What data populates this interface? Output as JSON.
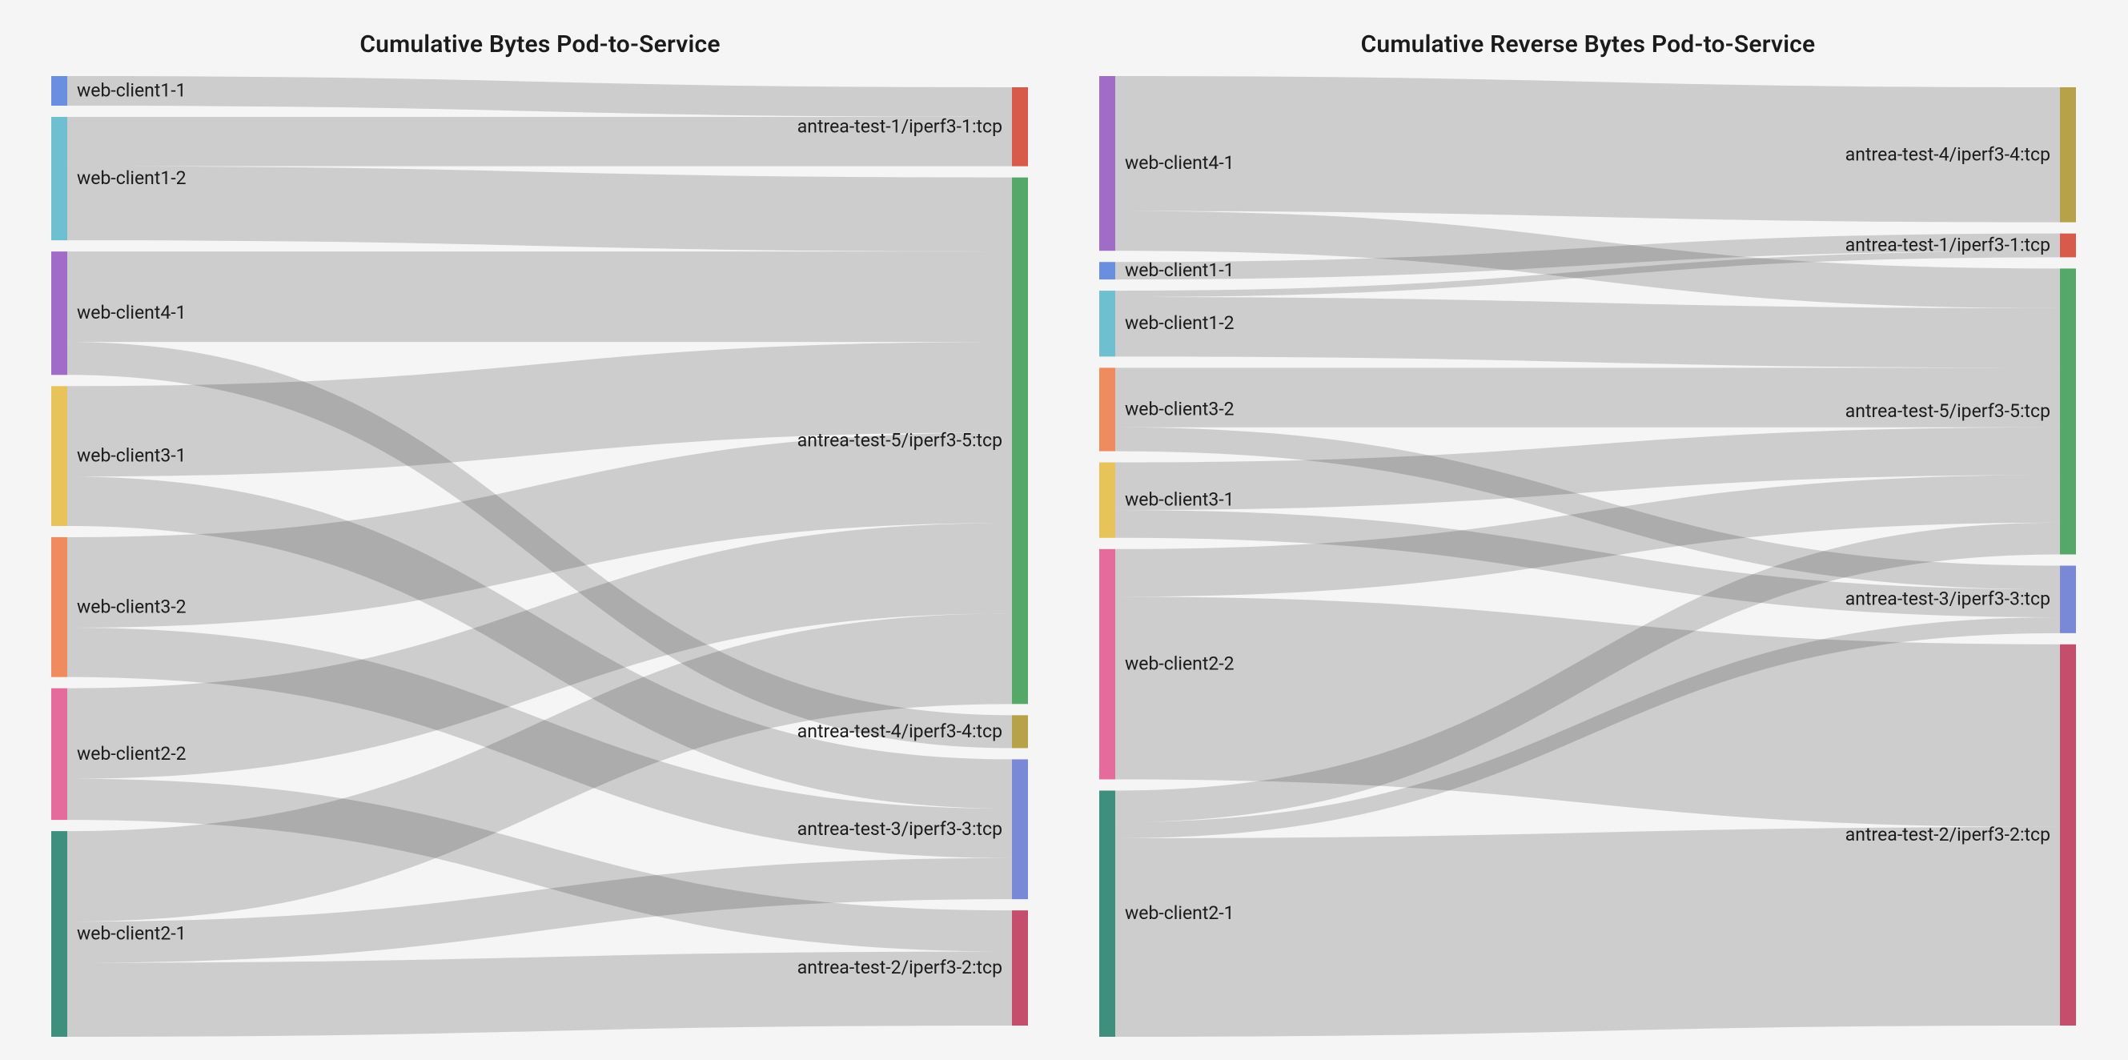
{
  "chart_data": [
    {
      "type": "sankey",
      "title": "Cumulative Bytes Pod-to-Service",
      "nodes": [
        {
          "id": "web-client1-1",
          "side": "L",
          "color": "#6b8fe0"
        },
        {
          "id": "web-client1-2",
          "side": "L",
          "color": "#6ec0d0"
        },
        {
          "id": "web-client4-1",
          "side": "L",
          "color": "#a06cc8"
        },
        {
          "id": "web-client3-1",
          "side": "L",
          "color": "#e7c35a"
        },
        {
          "id": "web-client3-2",
          "side": "L",
          "color": "#f08a5f"
        },
        {
          "id": "web-client2-2",
          "side": "L",
          "color": "#e66b9d"
        },
        {
          "id": "web-client2-1",
          "side": "L",
          "color": "#3f8f7f"
        },
        {
          "id": "antrea-test-1/iperf3-1:tcp",
          "side": "R",
          "color": "#d85a4a"
        },
        {
          "id": "antrea-test-5/iperf3-5:tcp",
          "side": "R",
          "color": "#55a868"
        },
        {
          "id": "antrea-test-4/iperf3-4:tcp",
          "side": "R",
          "color": "#b7a24a"
        },
        {
          "id": "antrea-test-3/iperf3-3:tcp",
          "side": "R",
          "color": "#7a88d8"
        },
        {
          "id": "antrea-test-2/iperf3-2:tcp",
          "side": "R",
          "color": "#c44e6b"
        }
      ],
      "links": [
        {
          "source": "web-client1-1",
          "target": "antrea-test-1/iperf3-1:tcp",
          "value": 36
        },
        {
          "source": "web-client1-2",
          "target": "antrea-test-1/iperf3-1:tcp",
          "value": 60
        },
        {
          "source": "web-client1-2",
          "target": "antrea-test-5/iperf3-5:tcp",
          "value": 90
        },
        {
          "source": "web-client4-1",
          "target": "antrea-test-5/iperf3-5:tcp",
          "value": 110
        },
        {
          "source": "web-client4-1",
          "target": "antrea-test-4/iperf3-4:tcp",
          "value": 40
        },
        {
          "source": "web-client3-1",
          "target": "antrea-test-5/iperf3-5:tcp",
          "value": 110
        },
        {
          "source": "web-client3-1",
          "target": "antrea-test-3/iperf3-3:tcp",
          "value": 60
        },
        {
          "source": "web-client3-2",
          "target": "antrea-test-5/iperf3-5:tcp",
          "value": 110
        },
        {
          "source": "web-client3-2",
          "target": "antrea-test-3/iperf3-3:tcp",
          "value": 60
        },
        {
          "source": "web-client2-2",
          "target": "antrea-test-5/iperf3-5:tcp",
          "value": 110
        },
        {
          "source": "web-client2-2",
          "target": "antrea-test-2/iperf3-2:tcp",
          "value": 50
        },
        {
          "source": "web-client2-1",
          "target": "antrea-test-5/iperf3-5:tcp",
          "value": 110
        },
        {
          "source": "web-client2-1",
          "target": "antrea-test-3/iperf3-3:tcp",
          "value": 50
        },
        {
          "source": "web-client2-1",
          "target": "antrea-test-2/iperf3-2:tcp",
          "value": 90
        }
      ]
    },
    {
      "type": "sankey",
      "title": "Cumulative Reverse Bytes Pod-to-Service",
      "nodes": [
        {
          "id": "web-client4-1",
          "side": "L",
          "color": "#a06cc8"
        },
        {
          "id": "web-client1-1",
          "side": "L",
          "color": "#6b8fe0"
        },
        {
          "id": "web-client1-2",
          "side": "L",
          "color": "#6ec0d0"
        },
        {
          "id": "web-client3-2",
          "side": "L",
          "color": "#f08a5f"
        },
        {
          "id": "web-client3-1",
          "side": "L",
          "color": "#e7c35a"
        },
        {
          "id": "web-client2-2",
          "side": "L",
          "color": "#e66b9d"
        },
        {
          "id": "web-client2-1",
          "side": "L",
          "color": "#3f8f7f"
        },
        {
          "id": "antrea-test-4/iperf3-4:tcp",
          "side": "R",
          "color": "#b7a24a"
        },
        {
          "id": "antrea-test-1/iperf3-1:tcp",
          "side": "R",
          "color": "#d85a4a"
        },
        {
          "id": "antrea-test-5/iperf3-5:tcp",
          "side": "R",
          "color": "#55a868"
        },
        {
          "id": "antrea-test-3/iperf3-3:tcp",
          "side": "R",
          "color": "#7a88d8"
        },
        {
          "id": "antrea-test-2/iperf3-2:tcp",
          "side": "R",
          "color": "#c44e6b"
        }
      ],
      "links": [
        {
          "source": "web-client4-1",
          "target": "antrea-test-4/iperf3-4:tcp",
          "value": 170
        },
        {
          "source": "web-client4-1",
          "target": "antrea-test-5/iperf3-5:tcp",
          "value": 50
        },
        {
          "source": "web-client1-1",
          "target": "antrea-test-1/iperf3-1:tcp",
          "value": 22
        },
        {
          "source": "web-client1-2",
          "target": "antrea-test-1/iperf3-1:tcp",
          "value": 8
        },
        {
          "source": "web-client1-2",
          "target": "antrea-test-5/iperf3-5:tcp",
          "value": 75
        },
        {
          "source": "web-client3-2",
          "target": "antrea-test-5/iperf3-5:tcp",
          "value": 75
        },
        {
          "source": "web-client3-2",
          "target": "antrea-test-3/iperf3-3:tcp",
          "value": 30
        },
        {
          "source": "web-client3-1",
          "target": "antrea-test-5/iperf3-5:tcp",
          "value": 60
        },
        {
          "source": "web-client3-1",
          "target": "antrea-test-3/iperf3-3:tcp",
          "value": 35
        },
        {
          "source": "web-client2-2",
          "target": "antrea-test-5/iperf3-5:tcp",
          "value": 60
        },
        {
          "source": "web-client2-2",
          "target": "antrea-test-2/iperf3-2:tcp",
          "value": 230
        },
        {
          "source": "web-client2-1",
          "target": "antrea-test-5/iperf3-5:tcp",
          "value": 40
        },
        {
          "source": "web-client2-1",
          "target": "antrea-test-3/iperf3-3:tcp",
          "value": 20
        },
        {
          "source": "web-client2-1",
          "target": "antrea-test-2/iperf3-2:tcp",
          "value": 250
        }
      ]
    }
  ]
}
